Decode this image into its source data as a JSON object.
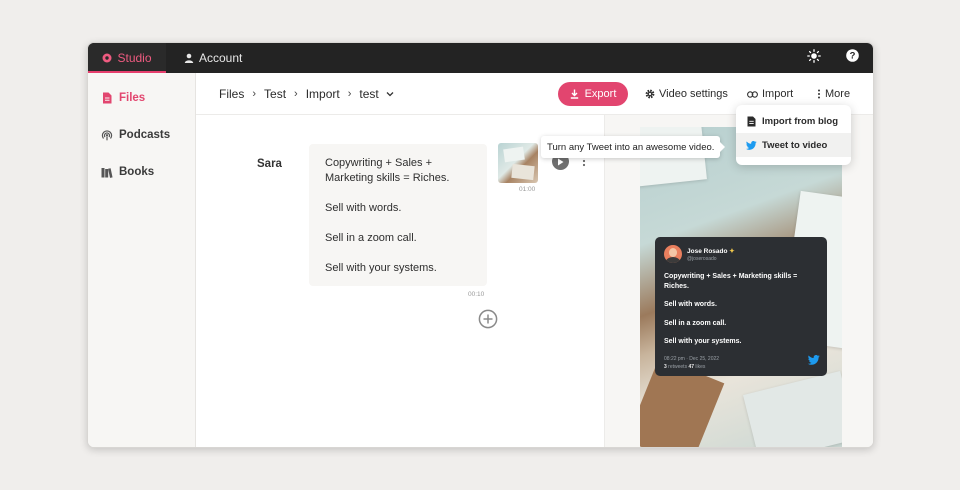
{
  "topbar": {
    "tabs": [
      {
        "label": "Studio",
        "icon": "studio-icon"
      },
      {
        "label": "Account",
        "icon": "user-icon"
      }
    ],
    "right_icons": [
      "sun-icon",
      "help-icon"
    ]
  },
  "sidebar": {
    "items": [
      {
        "label": "Files",
        "icon": "file-icon",
        "active": true
      },
      {
        "label": "Podcasts",
        "icon": "podcast-icon",
        "active": false
      },
      {
        "label": "Books",
        "icon": "book-icon",
        "active": false
      }
    ]
  },
  "header": {
    "breadcrumbs": [
      "Files",
      "Test",
      "Import",
      "test"
    ],
    "export_label": "Export",
    "video_settings_label": "Video settings",
    "import_label": "Import",
    "more_label": "More"
  },
  "editor": {
    "speaker": "Sara",
    "paragraphs": [
      "Copywriting + Sales + Marketing skills = Riches.",
      "Sell with words.",
      "Sell in a zoom call.",
      "Sell with your systems."
    ],
    "text_duration": "00:10",
    "clip_duration": "01:00"
  },
  "tooltip": {
    "text": "Turn any Tweet into an awesome video."
  },
  "dropdown": {
    "items": [
      {
        "label": "Import from blog",
        "icon": "document-icon"
      },
      {
        "label": "Tweet to video",
        "icon": "twitter-icon"
      }
    ]
  },
  "tweet": {
    "name": "Jose Rosado",
    "handle": "@joserosado",
    "paragraphs": [
      "Copywriting + Sales + Marketing skills = Riches.",
      "Sell with words.",
      "Sell in a zoom call.",
      "Sell with your systems."
    ],
    "datetime": "08:22 pm · Dec 25, 2022",
    "retweets": "3",
    "retweets_label": "retweets",
    "likes": "47",
    "likes_label": "likes"
  },
  "colors": {
    "accent": "#e2456f",
    "topbar": "#232323",
    "twitter": "#1d9bf0"
  }
}
